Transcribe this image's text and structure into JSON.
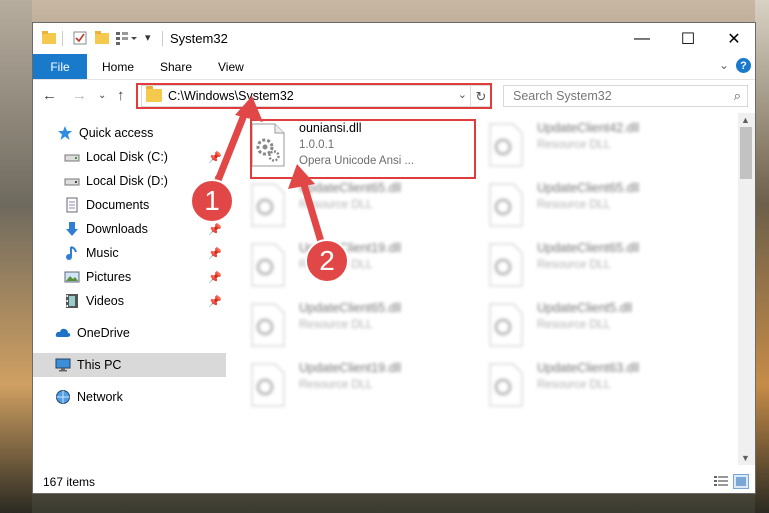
{
  "window": {
    "title": "System32",
    "controls": {
      "minimize": "—",
      "maximize": "☐",
      "close": "✕"
    }
  },
  "ribbon": {
    "tabs": [
      "File",
      "Home",
      "Share",
      "View"
    ],
    "help": "?"
  },
  "navigation": {
    "address": "C:\\Windows\\System32",
    "search_placeholder": "Search System32"
  },
  "sidebar": {
    "items": [
      {
        "label": "Quick access",
        "icon": "star-icon",
        "pinned": false
      },
      {
        "label": "Local Disk (C:)",
        "icon": "drive-icon",
        "pinned": true
      },
      {
        "label": "Local Disk (D:)",
        "icon": "drive-icon",
        "pinned": true
      },
      {
        "label": "Documents",
        "icon": "document-icon",
        "pinned": true
      },
      {
        "label": "Downloads",
        "icon": "download-icon",
        "pinned": true
      },
      {
        "label": "Music",
        "icon": "music-icon",
        "pinned": true
      },
      {
        "label": "Pictures",
        "icon": "pictures-icon",
        "pinned": true
      },
      {
        "label": "Videos",
        "icon": "videos-icon",
        "pinned": true
      },
      {
        "label": "OneDrive",
        "icon": "cloud-icon",
        "pinned": false
      },
      {
        "label": "This PC",
        "icon": "computer-icon",
        "pinned": false,
        "selected": true
      },
      {
        "label": "Network",
        "icon": "network-icon",
        "pinned": false
      }
    ]
  },
  "files": [
    {
      "name": "ouniansi.dll",
      "line2": "1.0.0.1",
      "line3": "Opera Unicode Ansi ...",
      "highlighted": true
    },
    {
      "name": "UpdateClient42.dll",
      "line2": "Resource DLL"
    },
    {
      "name": "UpdateClient65.dll",
      "line2": "Resource DLL"
    },
    {
      "name": "UpdateClient65.dll",
      "line2": "Resource DLL"
    },
    {
      "name": "UpdateClient19.dll",
      "line2": "Resource DLL"
    },
    {
      "name": "UpdateClient65.dll",
      "line2": "Resource DLL"
    },
    {
      "name": "UpdateClient65.dll",
      "line2": "Resource DLL"
    },
    {
      "name": "UpdateClient5.dll",
      "line2": "Resource DLL"
    },
    {
      "name": "UpdateClient19.dll",
      "line2": "Resource DLL"
    },
    {
      "name": "UpdateClient63.dll",
      "line2": "Resource DLL"
    }
  ],
  "status": {
    "item_count": "167 items"
  },
  "annotations": {
    "step1": "1",
    "step2": "2",
    "color": "#e23b3b"
  }
}
